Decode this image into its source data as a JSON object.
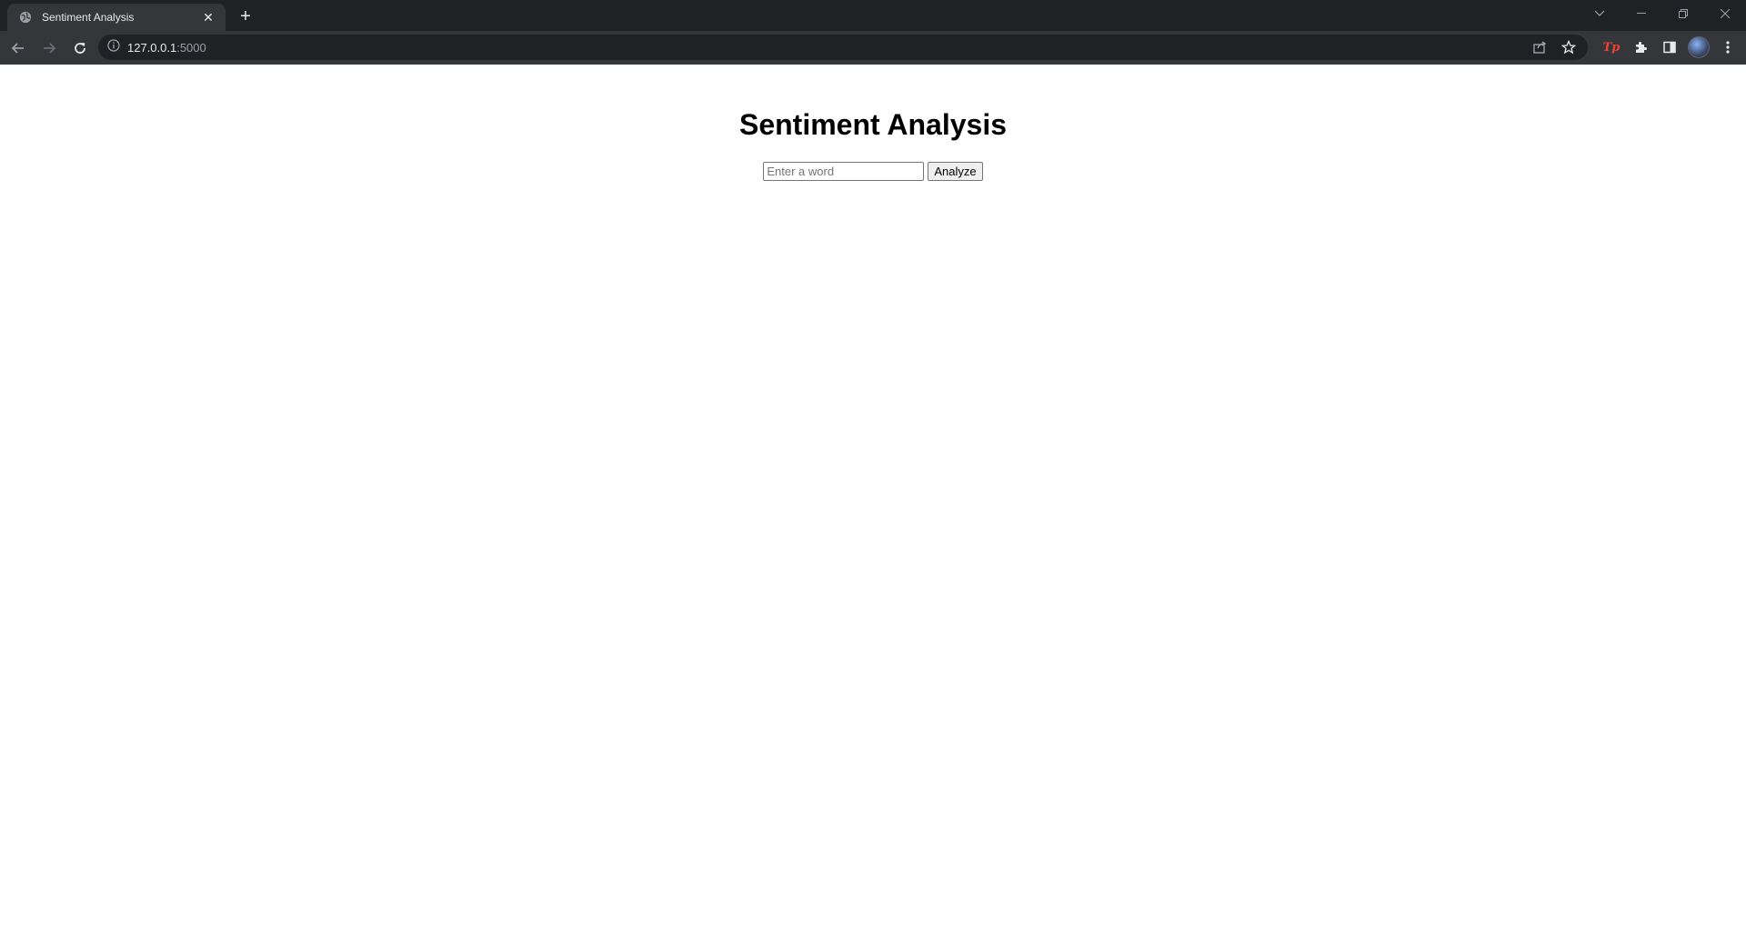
{
  "browser": {
    "tab": {
      "title": "Sentiment Analysis",
      "close_label": "✕"
    },
    "new_tab_label": "+",
    "address": {
      "host": "127.0.0.1",
      "port": ":5000"
    },
    "extension_tp_label": "Tp"
  },
  "page": {
    "title": "Sentiment Analysis",
    "input": {
      "placeholder": "Enter a word",
      "value": ""
    },
    "analyze_button": "Analyze"
  },
  "icons": {
    "tab_favicon": "globe-icon",
    "back": "arrow-left-icon",
    "forward": "arrow-right-icon",
    "reload": "reload-icon",
    "site_info": "info-icon",
    "share": "share-icon",
    "bookmark": "star-icon",
    "extensions": "puzzle-icon",
    "side_panel": "side-panel-icon",
    "profile": "avatar",
    "menu": "kebab-menu-icon"
  },
  "colors": {
    "tab_strip": "#202124",
    "toolbar": "#35363a",
    "omnibox": "#202124",
    "page_background": "#ffffff",
    "extension_accent": "#ea4335"
  }
}
